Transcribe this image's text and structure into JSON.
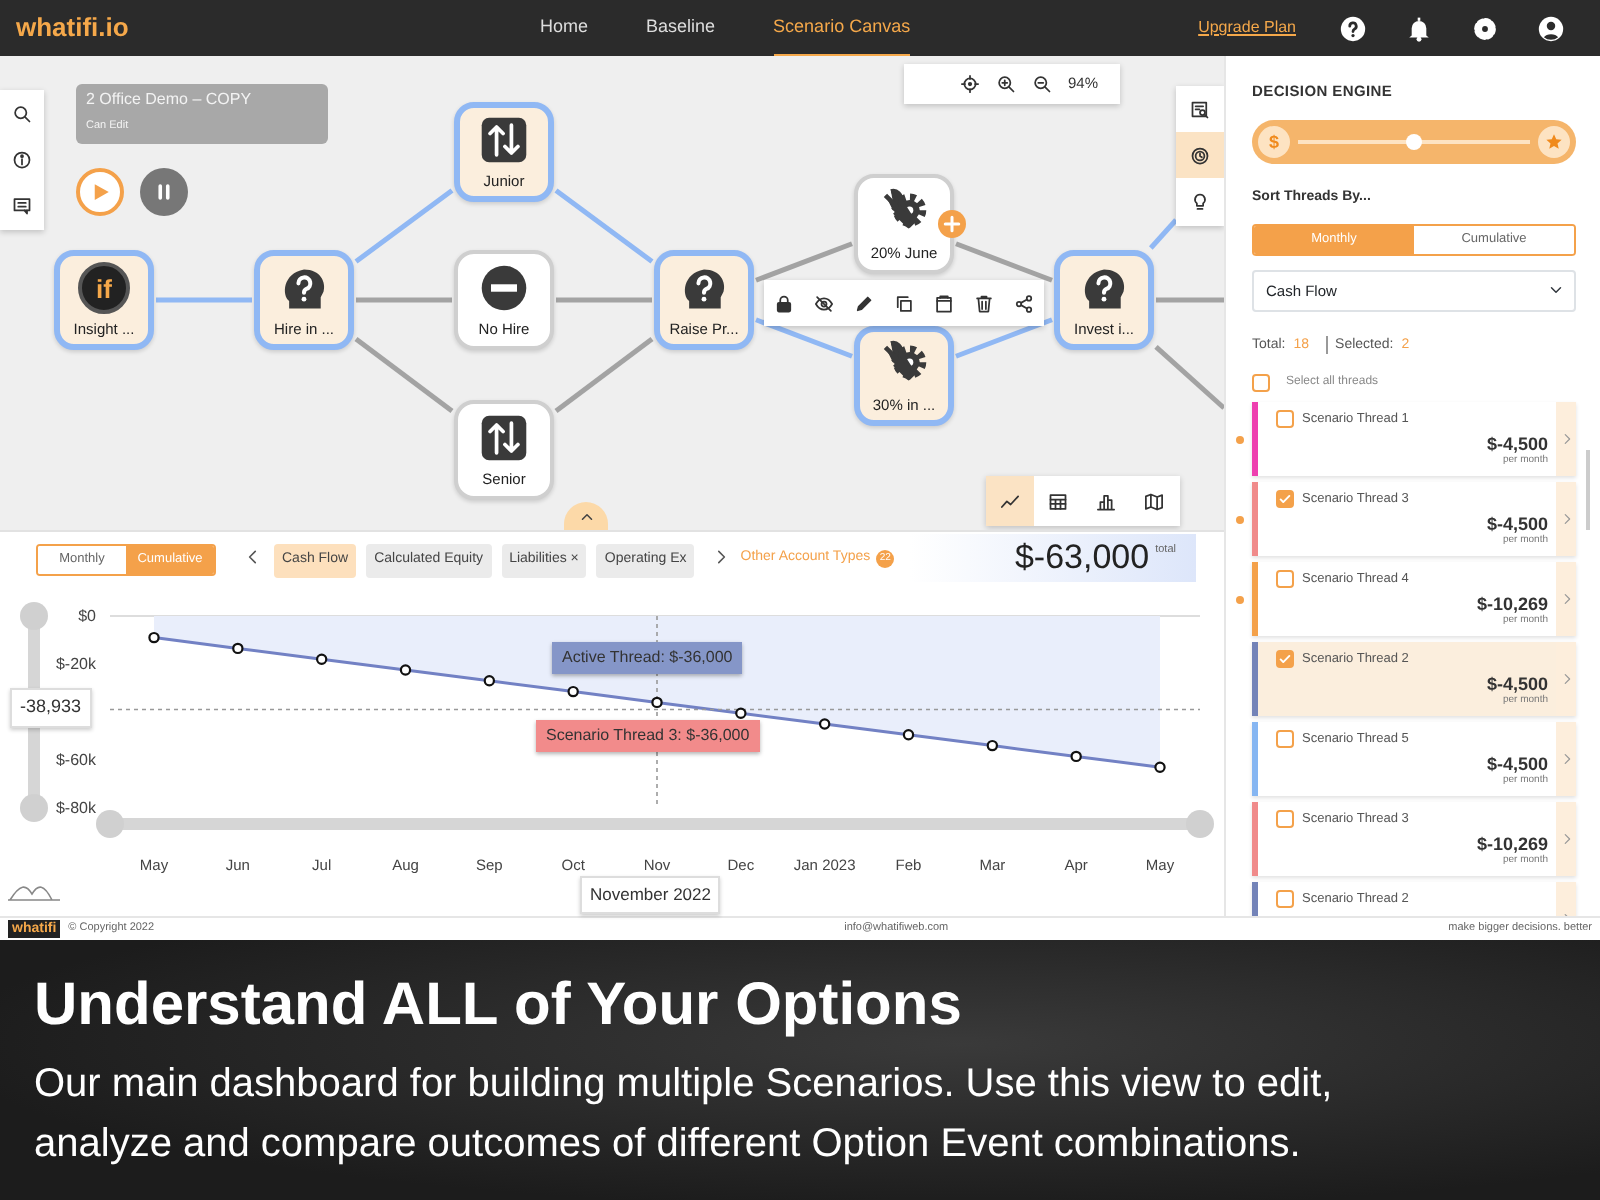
{
  "navbar": {
    "logo": "whatifi.io",
    "links": [
      {
        "label": "Home",
        "selected": false
      },
      {
        "label": "Baseline",
        "selected": false
      },
      {
        "label": "Scenario Canvas",
        "selected": true
      }
    ],
    "upgrade": "Upgrade Plan"
  },
  "canvas": {
    "scenario": {
      "title": "2 Office Demo – COPY",
      "subtitle": "Can Edit"
    },
    "zoom": "94%",
    "side_tools": [
      {
        "kind": "report",
        "selected": false
      },
      {
        "kind": "clock",
        "selected": true
      },
      {
        "kind": "bulb",
        "selected": false
      }
    ],
    "nodes": [
      {
        "label": "Insight ...",
        "kind": "insight",
        "mark": "if",
        "active": true,
        "add": false
      },
      {
        "label": "Hire in ...",
        "kind": "decision",
        "active": true,
        "add": false
      },
      {
        "label": "Junior",
        "kind": "swap",
        "active": true,
        "add": false
      },
      {
        "label": "No Hire",
        "kind": "none",
        "active": false,
        "add": false
      },
      {
        "label": "Senior",
        "kind": "swap",
        "active": false,
        "add": false
      },
      {
        "label": "Raise Pr...",
        "kind": "decision",
        "active": true,
        "add": false
      },
      {
        "label": "20% June",
        "kind": "tools",
        "active": false,
        "add": true
      },
      {
        "label": "30% in ...",
        "kind": "tools",
        "active": true,
        "add": false
      },
      {
        "label": "Invest i...",
        "kind": "decision",
        "active": true,
        "add": false
      }
    ],
    "chart_types": [
      {
        "kind": "line",
        "selected": true
      },
      {
        "kind": "table",
        "selected": false
      },
      {
        "kind": "bar",
        "selected": false
      },
      {
        "kind": "map",
        "selected": false
      }
    ]
  },
  "chart_panel": {
    "basis": [
      {
        "label": "Monthly",
        "selected": false
      },
      {
        "label": "Cumulative",
        "selected": true
      }
    ],
    "accounts": [
      {
        "label": "Cash Flow",
        "selected": true
      },
      {
        "label": "Calculated Equity",
        "selected": false
      },
      {
        "label": "Liabilities",
        "selected": false,
        "remove": "×"
      },
      {
        "label": "Operating Ex",
        "selected": false
      }
    ],
    "other_types": {
      "label": "Other Account Types",
      "count": "22"
    },
    "total": {
      "value": "$-63,000",
      "label": "total"
    },
    "y_marker": "-38,933",
    "tooltips": [
      {
        "text": "Active Thread: $-36,000",
        "color": "#8596c8"
      },
      {
        "text": "Scenario Thread 3: $-36,000",
        "color": "#f28b8b"
      }
    ],
    "x_marker": "November 2022",
    "chart_data": {
      "type": "area",
      "categories": [
        "May",
        "Jun",
        "Jul",
        "Aug",
        "Sep",
        "Oct",
        "Nov",
        "Dec",
        "Jan 2023",
        "Feb",
        "Mar",
        "Apr",
        "May"
      ],
      "series": [
        {
          "color": "#7281c4",
          "values": [
            -9000,
            -13500,
            -18000,
            -22500,
            -27000,
            -31500,
            -36000,
            -40500,
            -45000,
            -49500,
            -54000,
            -58500,
            -63000
          ]
        }
      ],
      "ylim": [
        -80000,
        0
      ],
      "yticks": [
        {
          "value": 0,
          "label": "$0"
        },
        {
          "value": -20000,
          "label": "$-20k"
        },
        {
          "value": -60000,
          "label": "$-60k"
        },
        {
          "value": -80000,
          "label": "$-80k"
        }
      ]
    }
  },
  "sidebar": {
    "title": "DECISION ENGINE",
    "priority": {
      "start": "$",
      "level": 0.5
    },
    "sort_label": "Sort Threads By...",
    "sort_basis": [
      {
        "label": "Monthly",
        "selected": true
      },
      {
        "label": "Cumulative",
        "selected": false
      }
    ],
    "sort_field": "Cash Flow",
    "total_label": "Total:",
    "total": "18",
    "selected_label": "Selected:",
    "selected": "2",
    "select_all": {
      "label": "Select all threads",
      "checked": false
    },
    "threads": [
      {
        "name": "Scenario Thread 1",
        "amount": "$-4,500",
        "period": "per month",
        "color": "#ee3fb0",
        "checked": false,
        "selected": false,
        "flagged": true
      },
      {
        "name": "Scenario Thread 3",
        "amount": "$-4,500",
        "period": "per month",
        "color": "#f08a8a",
        "checked": true,
        "selected": false,
        "flagged": true
      },
      {
        "name": "Scenario Thread 4",
        "amount": "$-10,269",
        "period": "per month",
        "color": "#f4a14a",
        "checked": false,
        "selected": false,
        "flagged": true
      },
      {
        "name": "Scenario Thread 2",
        "amount": "$-4,500",
        "period": "per month",
        "color": "#7383b8",
        "checked": true,
        "selected": true,
        "flagged": false
      },
      {
        "name": "Scenario Thread 5",
        "amount": "$-4,500",
        "period": "per month",
        "color": "#86b6f2",
        "checked": false,
        "selected": false,
        "flagged": false
      },
      {
        "name": "Scenario Thread 3",
        "amount": "$-10,269",
        "period": "per month",
        "color": "#f08a8a",
        "checked": false,
        "selected": false,
        "flagged": false
      },
      {
        "name": "Scenario Thread 2",
        "color": "#7383b8",
        "checked": false,
        "selected": false,
        "flagged": false
      }
    ]
  },
  "footer": {
    "logo": "whatifi",
    "copyright": "© Copyright 2022",
    "email": "info@whatifiweb.com",
    "tagline": "make bigger decisions. better"
  },
  "caption": {
    "title": "Understand ALL of Your Options",
    "text": "Our main dashboard for building multiple Scenarios. Use this view to edit, analyze and compare outcomes of different Option Event combinations."
  }
}
